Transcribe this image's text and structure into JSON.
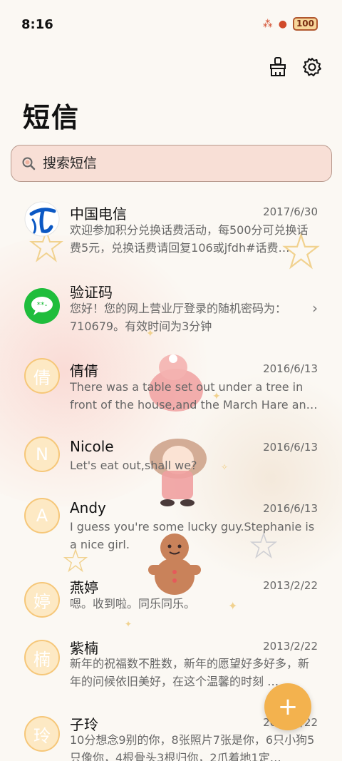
{
  "status_bar": {
    "time": "8:16",
    "battery": "100"
  },
  "title": "短信",
  "search": {
    "placeholder": "搜索短信"
  },
  "messages": [
    {
      "sender": "中国电信",
      "date": "2017/6/30",
      "preview": "欢迎参加积分兑换话费活动，每500分可兑换话费5元，兑换话费请回复106或jfdh#话费…",
      "avatar": "china-telecom-logo"
    },
    {
      "sender": "验证码",
      "date": "",
      "preview": "您好！您的网上营业厅登录的随机密码为：710679。有效时间为3分钟",
      "avatar": "message-bubble-icon"
    },
    {
      "sender": "倩倩",
      "date": "2016/6/13",
      "preview": "There was a table set out under a tree in front of the house,and the March Hare an…",
      "avatar_letter": "倩"
    },
    {
      "sender": "Nicole",
      "date": "2016/6/13",
      "preview": "Let's eat out,shall we?",
      "avatar_letter": "N"
    },
    {
      "sender": "Andy",
      "date": "2016/6/13",
      "preview": "I guess you're some lucky guy.Stephanie is a nice girl.",
      "avatar_letter": "A"
    },
    {
      "sender": "燕婷",
      "date": "2013/2/22",
      "preview": "嗯。收到啦。同乐同乐。",
      "avatar_letter": "婷"
    },
    {
      "sender": "紫楠",
      "date": "2013/2/22",
      "preview": "新年的祝福数不胜数，新年的愿望好多好多，新年的问候依旧美好，在这个温馨的时刻 …",
      "avatar_letter": "楠"
    },
    {
      "sender": "子玲",
      "date": "2013/2/22",
      "preview": "10分想念9别的你，8张照片7张是你，6只小狗5只像你，4根骨头3根归你，2爪着地1定…",
      "avatar_letter": "玲"
    }
  ],
  "fab": {
    "label": "+"
  },
  "colors": {
    "accent": "#f3b24e",
    "search_bg": "#f8dfd6",
    "avatar_bg": "#fde9c4"
  }
}
